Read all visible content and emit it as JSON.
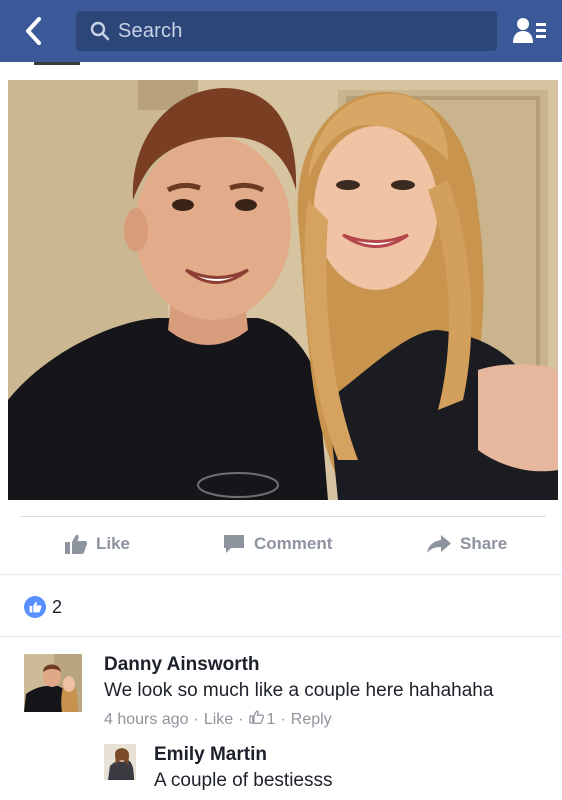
{
  "header": {
    "back_icon": "chevron-left-icon",
    "search_placeholder": "Search",
    "friends_icon": "friend-requests-icon",
    "bar_color": "#3b5998"
  },
  "post": {
    "photo": "selfie of a young man and woman smiling",
    "actions": [
      {
        "label": "Like",
        "icon": "thumbs-up-icon"
      },
      {
        "label": "Comment",
        "icon": "comment-icon"
      },
      {
        "label": "Share",
        "icon": "share-arrow-icon"
      }
    ],
    "reactions": {
      "count": "2",
      "icon": "like-reaction-icon"
    }
  },
  "comments": [
    {
      "name": "Danny Ainsworth",
      "text": "We look so much like a couple here hahahaha",
      "time": "4 hours ago",
      "like_label": "Like",
      "likes": "1",
      "reply_label": "Reply"
    },
    {
      "name": "Emily Martin",
      "text": "A couple of bestiesss"
    }
  ]
}
